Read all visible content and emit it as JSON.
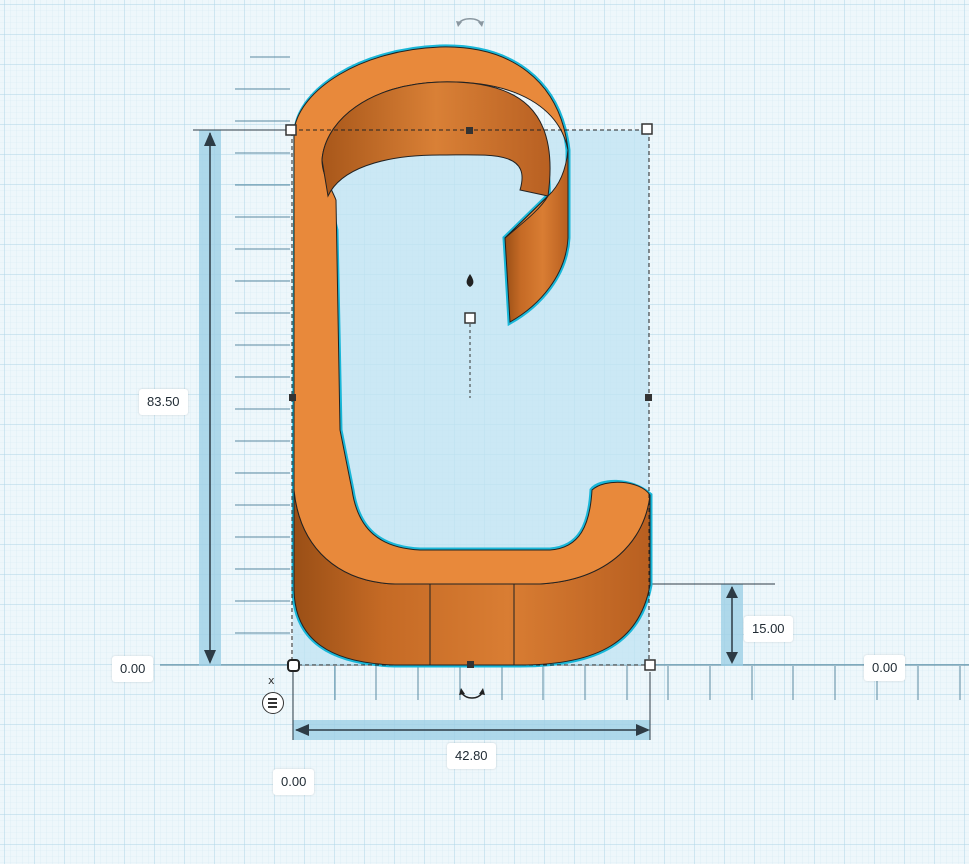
{
  "dimensions": {
    "height_label": "83.50",
    "width_label": "42.80",
    "elevation_label": "15.00",
    "origin_x_left": "0.00",
    "origin_x_right": "0.00",
    "origin_bottom": "0.00"
  },
  "controls": {
    "close_glyph": "x"
  },
  "colors": {
    "workplane_bg": "#eef7fb",
    "grid_minor": "#c9e3ef",
    "grid_major": "#a9d2e5",
    "shape_top": "#e8893b",
    "shape_side_dark": "#b35f1f",
    "shape_outline": "#1fb6d4",
    "selection_fill": "#b9e2f3",
    "dimension_bar": "#8ec9e2"
  },
  "icons": {
    "rotate_top": "rotate-arrow-icon",
    "rotate_bottom": "rotate-arrow-icon",
    "lift_cone": "lift-cone-icon",
    "menu": "hamburger-menu-icon",
    "close": "close-icon"
  }
}
